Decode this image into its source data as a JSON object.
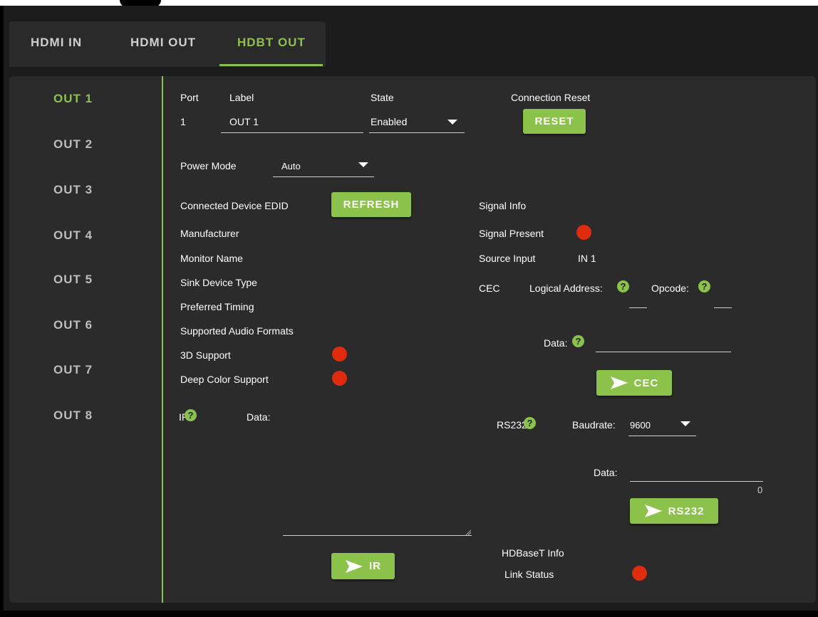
{
  "tabs": [
    {
      "label": "HDMI IN"
    },
    {
      "label": "HDMI OUT"
    },
    {
      "label": "HDBT OUT"
    }
  ],
  "sidebar": {
    "items": [
      {
        "label": "OUT 1"
      },
      {
        "label": "OUT 2"
      },
      {
        "label": "OUT 3"
      },
      {
        "label": "OUT 4"
      },
      {
        "label": "OUT 5"
      },
      {
        "label": "OUT 6"
      },
      {
        "label": "OUT 7"
      },
      {
        "label": "OUT 8"
      }
    ]
  },
  "port": {
    "port_header": "Port",
    "label_header": "Label",
    "state_header": "State",
    "reset_header": "Connection Reset",
    "port_value": "1",
    "label_value": "OUT 1",
    "state_value": "Enabled",
    "reset_button": "RESET"
  },
  "power": {
    "label": "Power Mode",
    "value": "Auto"
  },
  "edid": {
    "title": "Connected Device EDID",
    "refresh_button": "REFRESH",
    "manufacturer": "Manufacturer",
    "monitor_name": "Monitor Name",
    "sink_type": "Sink Device Type",
    "preferred_timing": "Preferred Timing",
    "audio_formats": "Supported Audio Formats",
    "support_3d": "3D Support",
    "deep_color": "Deep Color Support"
  },
  "signal": {
    "title": "Signal Info",
    "present_label": "Signal Present",
    "source_label": "Source Input",
    "source_value": "IN 1"
  },
  "cec": {
    "label": "CEC",
    "logical_address": "Logical Address:",
    "opcode": "Opcode:",
    "data_label": "Data:",
    "button": "CEC"
  },
  "ir": {
    "label": "IR",
    "data_label": "Data:",
    "button": "IR"
  },
  "rs232": {
    "label": "RS232",
    "baudrate_label": "Baudrate:",
    "baudrate_value": "9600",
    "data_label": "Data:",
    "counter": "0",
    "button": "RS232"
  },
  "hdbaset": {
    "title": "HDBaseT Info",
    "link_status": "Link Status"
  },
  "colors": {
    "accent": "#8bc34a",
    "status_off": "#e02b0c",
    "panel": "#2b2b2b"
  },
  "icons": {
    "send": "send-arrow-icon",
    "help": "help-icon",
    "dropdown": "caret-down-icon"
  }
}
